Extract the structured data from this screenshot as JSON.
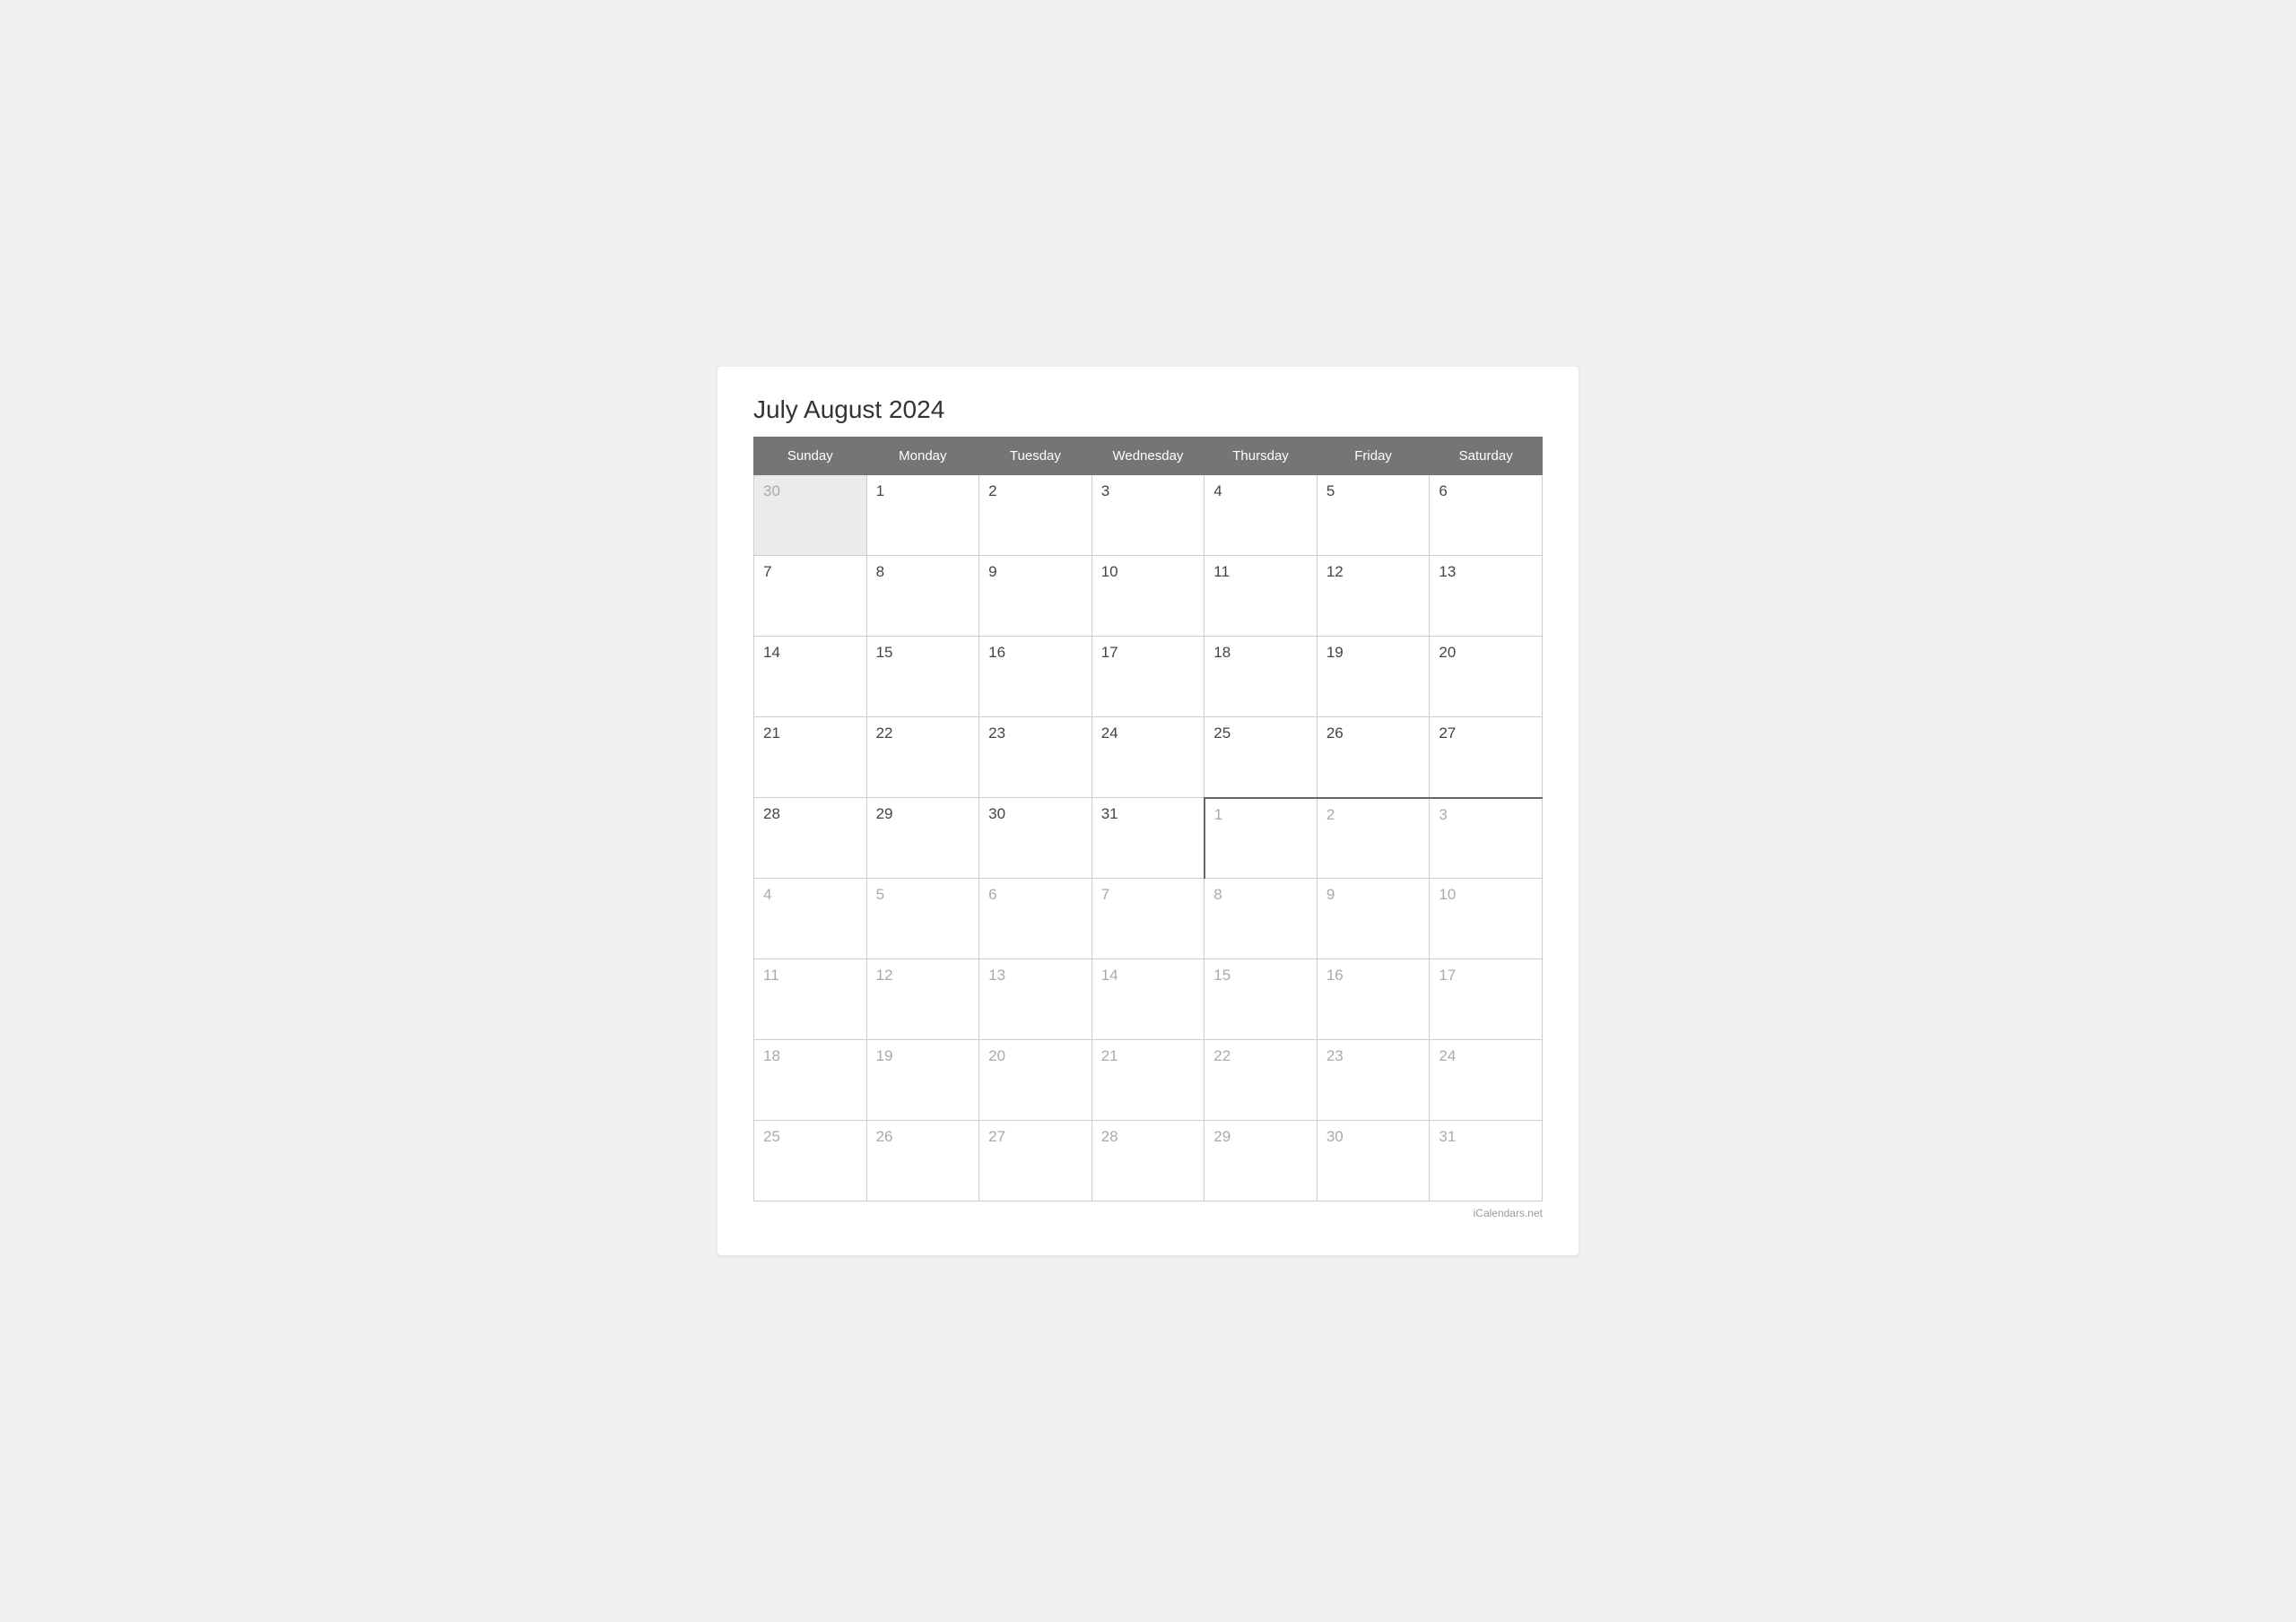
{
  "title": "July August 2024",
  "watermark": "iCalendars.net",
  "headers": [
    "Sunday",
    "Monday",
    "Tuesday",
    "Wednesday",
    "Thursday",
    "Friday",
    "Saturday"
  ],
  "weeks": [
    [
      {
        "day": "30",
        "type": "prev-month"
      },
      {
        "day": "1",
        "type": "current"
      },
      {
        "day": "2",
        "type": "current"
      },
      {
        "day": "3",
        "type": "current"
      },
      {
        "day": "4",
        "type": "current"
      },
      {
        "day": "5",
        "type": "current"
      },
      {
        "day": "6",
        "type": "current"
      }
    ],
    [
      {
        "day": "7",
        "type": "current"
      },
      {
        "day": "8",
        "type": "current"
      },
      {
        "day": "9",
        "type": "current"
      },
      {
        "day": "10",
        "type": "current"
      },
      {
        "day": "11",
        "type": "current"
      },
      {
        "day": "12",
        "type": "current"
      },
      {
        "day": "13",
        "type": "current"
      }
    ],
    [
      {
        "day": "14",
        "type": "current"
      },
      {
        "day": "15",
        "type": "current"
      },
      {
        "day": "16",
        "type": "current"
      },
      {
        "day": "17",
        "type": "current"
      },
      {
        "day": "18",
        "type": "current"
      },
      {
        "day": "19",
        "type": "current"
      },
      {
        "day": "20",
        "type": "current"
      }
    ],
    [
      {
        "day": "21",
        "type": "current"
      },
      {
        "day": "22",
        "type": "current"
      },
      {
        "day": "23",
        "type": "current"
      },
      {
        "day": "24",
        "type": "current"
      },
      {
        "day": "25",
        "type": "current"
      },
      {
        "day": "26",
        "type": "current"
      },
      {
        "day": "27",
        "type": "current"
      }
    ],
    [
      {
        "day": "28",
        "type": "current"
      },
      {
        "day": "29",
        "type": "current"
      },
      {
        "day": "30",
        "type": "current"
      },
      {
        "day": "31",
        "type": "current"
      },
      {
        "day": "1",
        "type": "next-month month-divider-top month-divider-left"
      },
      {
        "day": "2",
        "type": "next-month month-divider-top"
      },
      {
        "day": "3",
        "type": "next-month month-divider-top"
      }
    ],
    [
      {
        "day": "4",
        "type": "next-month"
      },
      {
        "day": "5",
        "type": "next-month"
      },
      {
        "day": "6",
        "type": "next-month"
      },
      {
        "day": "7",
        "type": "next-month"
      },
      {
        "day": "8",
        "type": "next-month"
      },
      {
        "day": "9",
        "type": "next-month"
      },
      {
        "day": "10",
        "type": "next-month"
      }
    ],
    [
      {
        "day": "11",
        "type": "next-month"
      },
      {
        "day": "12",
        "type": "next-month"
      },
      {
        "day": "13",
        "type": "next-month"
      },
      {
        "day": "14",
        "type": "next-month"
      },
      {
        "day": "15",
        "type": "next-month"
      },
      {
        "day": "16",
        "type": "next-month"
      },
      {
        "day": "17",
        "type": "next-month"
      }
    ],
    [
      {
        "day": "18",
        "type": "next-month"
      },
      {
        "day": "19",
        "type": "next-month"
      },
      {
        "day": "20",
        "type": "next-month"
      },
      {
        "day": "21",
        "type": "next-month"
      },
      {
        "day": "22",
        "type": "next-month"
      },
      {
        "day": "23",
        "type": "next-month"
      },
      {
        "day": "24",
        "type": "next-month"
      }
    ],
    [
      {
        "day": "25",
        "type": "next-month"
      },
      {
        "day": "26",
        "type": "next-month"
      },
      {
        "day": "27",
        "type": "next-month"
      },
      {
        "day": "28",
        "type": "next-month"
      },
      {
        "day": "29",
        "type": "next-month"
      },
      {
        "day": "30",
        "type": "next-month"
      },
      {
        "day": "31",
        "type": "next-month"
      }
    ]
  ]
}
